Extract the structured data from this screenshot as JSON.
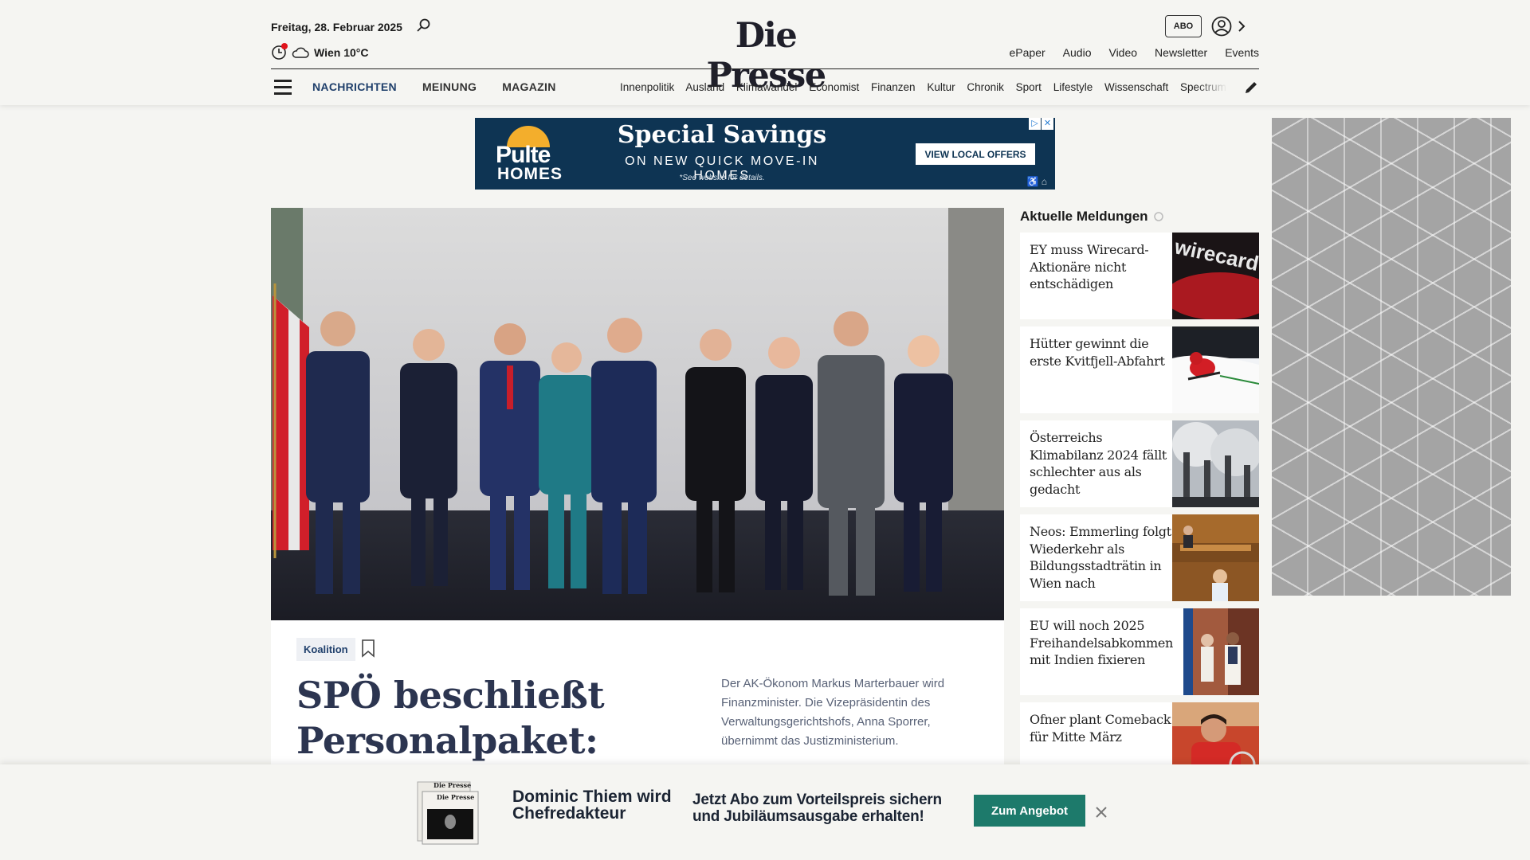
{
  "header": {
    "date": "Freitag, 28. Februar 2025",
    "weather": "Wien 10°C",
    "logo": "Die Presse",
    "abo_label": "ABO",
    "service_links": [
      "ePaper",
      "Audio",
      "Video",
      "Newsletter",
      "Events"
    ]
  },
  "nav": {
    "main": [
      "NACHRICHTEN",
      "MEINUNG",
      "MAGAZIN"
    ],
    "sub": [
      "Innenpolitik",
      "Ausland",
      "Klimawandel",
      "Economist",
      "Finanzen",
      "Kultur",
      "Chronik",
      "Sport",
      "Lifestyle",
      "Wissenschaft",
      "Spectrum"
    ]
  },
  "ad": {
    "brand": "Pulte",
    "brand_sub": "HOMES",
    "headline": "Special Savings",
    "subline": "ON NEW QUICK MOVE-IN HOMES",
    "note": "*See website for details.",
    "cta": "VIEW LOCAL OFFERS"
  },
  "lead": {
    "tag": "Koalition",
    "headline": "SPÖ beschließt Personalpaket: „Werden",
    "teaser": "Der AK-Ökonom Markus Marterbauer wird Finanzminister. Die Vizepräsidentin des Verwaltungsgerichtshofs, Anna Sporrer, übernimmt das Justizministerium."
  },
  "news": {
    "title": "Aktuelle Meldungen",
    "items": [
      {
        "title": "EY muss Wirecard-Aktionäre nicht entschädigen",
        "thumb": "wirecard"
      },
      {
        "title": "Hütter gewinnt die erste Kvitfjell-Abfahrt",
        "thumb": "ski"
      },
      {
        "title": "Österreichs Klimabilanz 2024 fällt schlechter aus als gedacht",
        "thumb": "chimneys"
      },
      {
        "title": "Neos: Emmerling folgt Wiederkehr als Bildungsstadträtin in Wien nach",
        "thumb": "parliament"
      },
      {
        "title": "EU will noch 2025 Freihandelsabkommen mit Indien fixieren",
        "thumb": "leaders"
      },
      {
        "title": "Ofner plant Comeback für Mitte März",
        "thumb": "tennis"
      }
    ]
  },
  "promo": {
    "name": "Dominic Thiem wird Chefredakteur",
    "text": "Jetzt Abo zum Vorteilspreis sichern und Jubiläumsausgabe erhalten!",
    "button": "Zum Angebot",
    "paper_logo": "Die Presse"
  },
  "colors": {
    "nav_blue": "#1f3f6b",
    "headline": "#2c3550",
    "promo_button": "#1d7a6b",
    "ad_bg": "#0e3453"
  }
}
